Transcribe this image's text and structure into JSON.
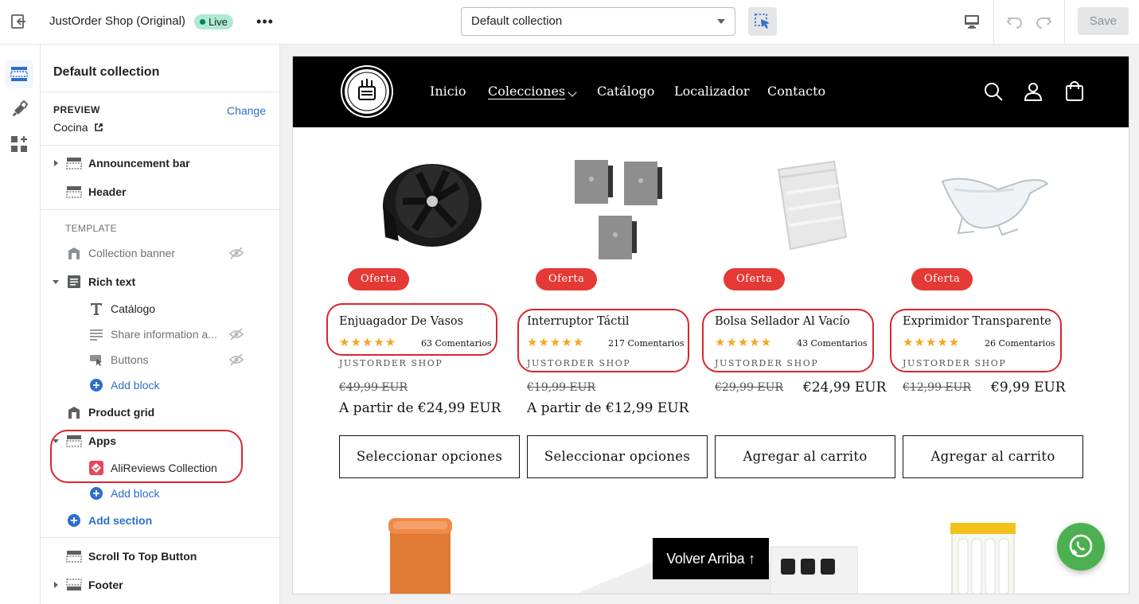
{
  "topbar": {
    "shop_name": "JustOrder Shop (Original)",
    "status": "Live",
    "more": "•••",
    "template_select": "Default collection",
    "save": "Save"
  },
  "sidebar": {
    "title": "Default collection",
    "preview_label": "PREVIEW",
    "change": "Change",
    "preview_value": "Cocina",
    "items": {
      "announcement": "Announcement bar",
      "header": "Header",
      "template_label": "TEMPLATE",
      "collection_banner": "Collection banner",
      "rich_text": "Rich text",
      "catalogo": "Catálogo",
      "share_info": "Share information a...",
      "buttons": "Buttons",
      "add_block_1": "Add block",
      "product_grid": "Product grid",
      "apps": "Apps",
      "alireviews": "AliReviews Collection",
      "add_block_2": "Add block",
      "add_section": "Add section",
      "scroll_top": "Scroll To Top Button",
      "footer": "Footer"
    }
  },
  "store": {
    "nav": [
      "Inicio",
      "Colecciones",
      "Catálogo",
      "Localizador",
      "Contacto"
    ],
    "products": [
      {
        "badge": "Oferta",
        "name": "Enjuagador De Vasos",
        "stars": "★★★★★",
        "reviews": "63 Comentarios",
        "vendor": "JUSTORDER SHOP",
        "old_price": "€49,99 EUR",
        "price": "A partir de €24,99 EUR",
        "button": "Seleccionar opciones"
      },
      {
        "badge": "Oferta",
        "name": "Interruptor Táctil",
        "stars": "★★★★★",
        "reviews": "217 Comentarios",
        "vendor": "JUSTORDER SHOP",
        "old_price": "€19,99 EUR",
        "price": "A partir de €12,99 EUR",
        "button": "Seleccionar opciones"
      },
      {
        "badge": "Oferta",
        "name": "Bolsa Sellador Al Vacío",
        "stars": "★★★★★",
        "reviews": "43 Comentarios",
        "vendor": "JUSTORDER SHOP",
        "old_price": "€29,99 EUR",
        "price": "€24,99 EUR",
        "button": "Agregar al carrito"
      },
      {
        "badge": "Oferta",
        "name": "Exprimidor Transparente",
        "stars": "★★★★★",
        "reviews": "26 Comentarios",
        "vendor": "JUSTORDER SHOP",
        "old_price": "€12,99 EUR",
        "price": "€9,99 EUR",
        "button": "Agregar al carrito"
      }
    ],
    "scroll_top": "Volver Arriba ↑"
  },
  "colors": {
    "accent": "#2c6ecb",
    "live": "#aee9d1",
    "badge": "#e53935",
    "highlight": "#d9262d",
    "whatsapp": "#4caf50"
  }
}
